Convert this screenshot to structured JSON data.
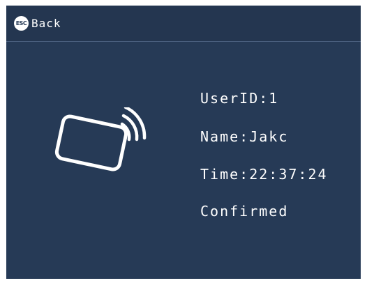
{
  "header": {
    "esc_badge": "ESC",
    "back_label": "Back"
  },
  "icon": {
    "name": "card-tap-icon"
  },
  "record": {
    "user_id": "UserID:1",
    "name": "Name:Jakc",
    "time": "Time:22:37:24",
    "status": "Confirmed"
  },
  "colors": {
    "background": "#263a56",
    "foreground": "#ffffff"
  }
}
